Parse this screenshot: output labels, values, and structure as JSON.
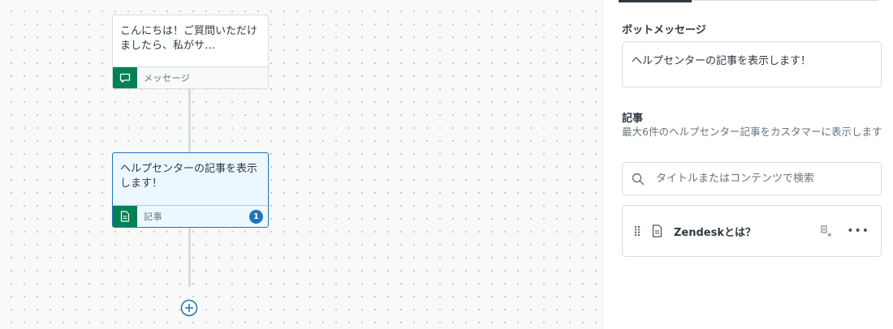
{
  "flow": {
    "steps": [
      {
        "text": "こんにちは！ご質問いただけましたら、私がサ…",
        "type_label": "メッセージ",
        "icon": "speech-bubble-icon"
      },
      {
        "text": "ヘルプセンターの記事を表示します！",
        "type_label": "記事",
        "badge": "1",
        "icon": "document-icon"
      }
    ],
    "add_icon": "plus-circle-icon"
  },
  "panel": {
    "bot_message": {
      "title": "ボットメッセージ",
      "value": "ヘルプセンターの記事を表示します！"
    },
    "articles": {
      "title": "記事",
      "hint": "最大6件のヘルプセンター記事をカスタマーに表示します",
      "search_placeholder": "タイトルまたはコンテンツで検索",
      "items": [
        {
          "title": "Zendeskとは？"
        }
      ]
    }
  },
  "colors": {
    "accent": "#1f73b7",
    "step_icon_bg": "#038153",
    "selected_bg": "#edf7ff"
  }
}
